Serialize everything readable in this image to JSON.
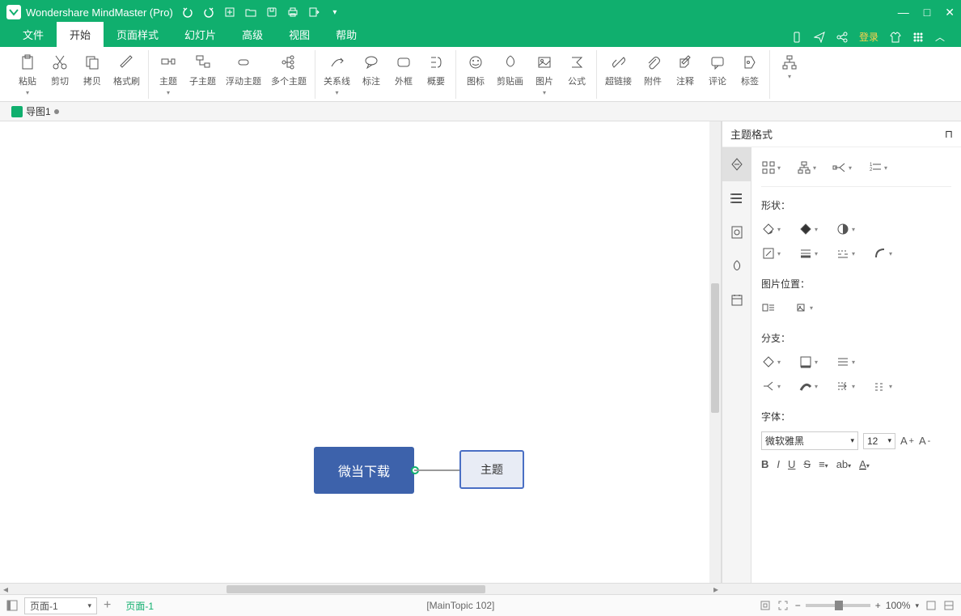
{
  "app": {
    "title": "Wondershare MindMaster (Pro)"
  },
  "menus": {
    "file": "文件",
    "start": "开始",
    "page_style": "页面样式",
    "slide": "幻灯片",
    "advanced": "高级",
    "view": "视图",
    "help": "帮助",
    "login": "登录"
  },
  "ribbon": {
    "paste": "粘贴",
    "cut": "剪切",
    "copy": "拷贝",
    "format_painter": "格式刷",
    "topic": "主题",
    "subtopic": "子主题",
    "floating": "浮动主题",
    "multiple": "多个主题",
    "relation": "关系线",
    "callout": "标注",
    "boundary": "外框",
    "summary": "概要",
    "icons": "图标",
    "clipart": "剪贴画",
    "picture": "图片",
    "formula": "公式",
    "hyperlink": "超链接",
    "attachment": "附件",
    "note": "注释",
    "comment": "评论",
    "tag": "标签"
  },
  "doc_tab": {
    "name": "导图1"
  },
  "canvas": {
    "main_topic": "微当下载",
    "sub_topic": "主题"
  },
  "sidepanel": {
    "title": "主题格式",
    "shape_label": "形状：",
    "image_pos_label": "图片位置：",
    "branch_label": "分支：",
    "font_label": "字体：",
    "font_name": "微软雅黑",
    "font_size": "12"
  },
  "statusbar": {
    "page_selector": "页面-1",
    "page_active": "页面-1",
    "info": "[MainTopic 102]",
    "zoom": "100%"
  }
}
